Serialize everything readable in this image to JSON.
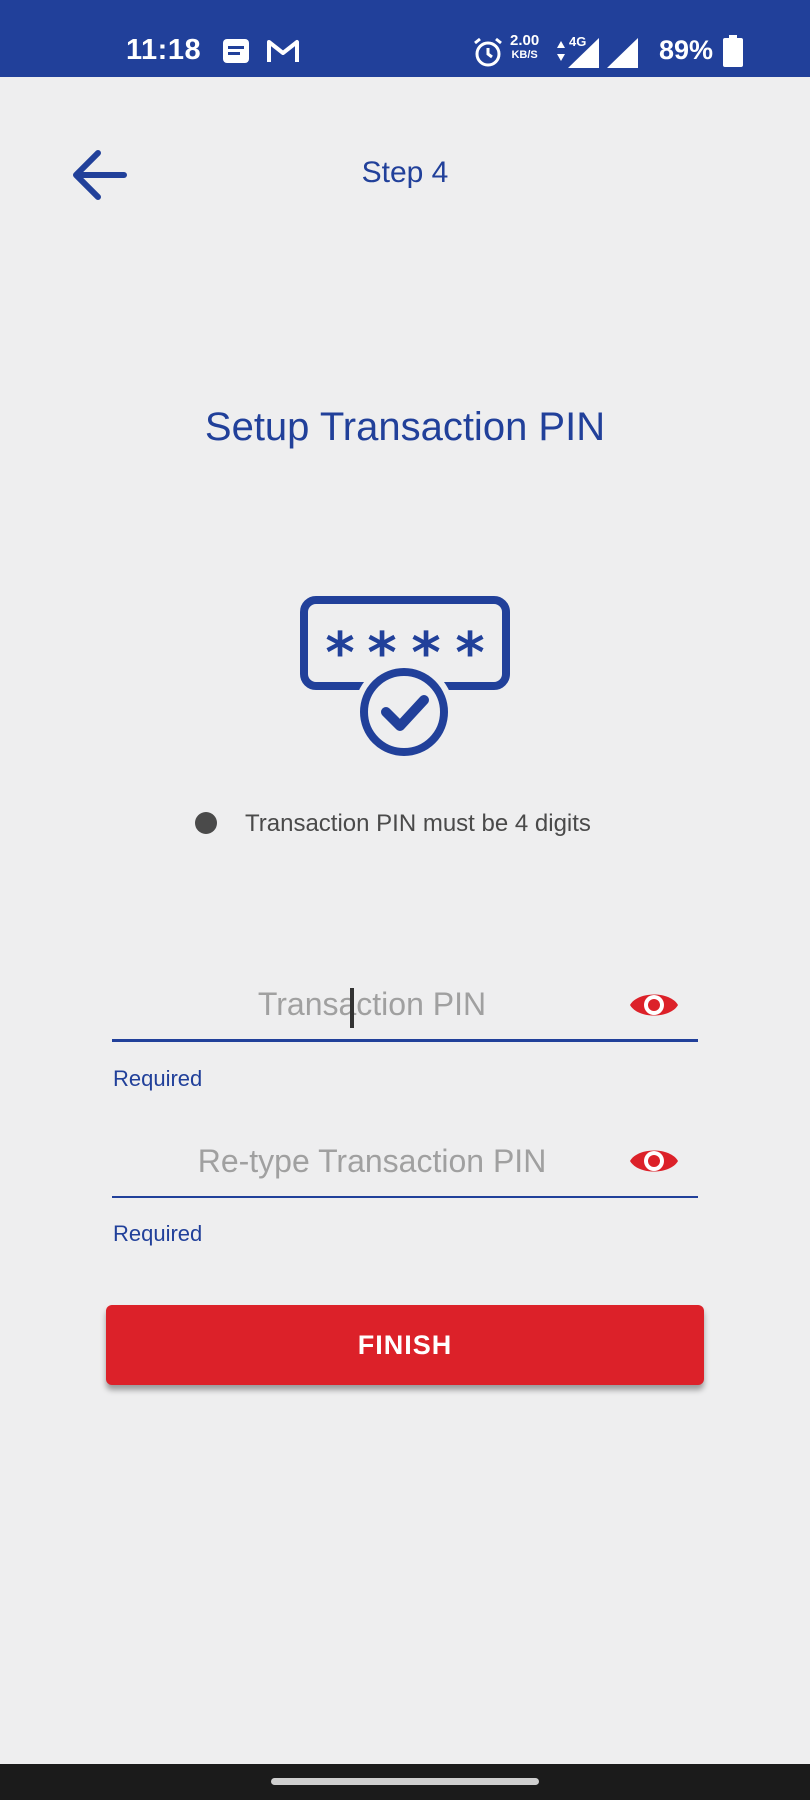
{
  "status_bar": {
    "time": "11:18",
    "speed_value": "2.00",
    "speed_unit": "KB/S",
    "network": "4G",
    "battery": "89%",
    "icons": [
      "message-icon",
      "gmail-icon",
      "alarm-icon",
      "data-arrows-icon",
      "signal-icon",
      "signal-icon",
      "battery-icon"
    ]
  },
  "header": {
    "back_icon": "arrow-left-icon",
    "step_title": "Step 4"
  },
  "main": {
    "title": "Setup Transaction PIN",
    "illustration_icon": "pin-check-icon",
    "rules": [
      {
        "text": "Transaction PIN must be 4 digits"
      }
    ],
    "fields": [
      {
        "placeholder": "Transaction PIN",
        "value": "",
        "helper": "Required",
        "toggle_icon": "eye-icon"
      },
      {
        "placeholder": "Re-type Transaction PIN",
        "value": "",
        "helper": "Required",
        "toggle_icon": "eye-icon"
      }
    ],
    "finish_label": "FINISH"
  },
  "colors": {
    "primary": "#21409a",
    "accent": "#dc2129",
    "background": "#eeeeef",
    "placeholder": "#a0a0a0"
  }
}
